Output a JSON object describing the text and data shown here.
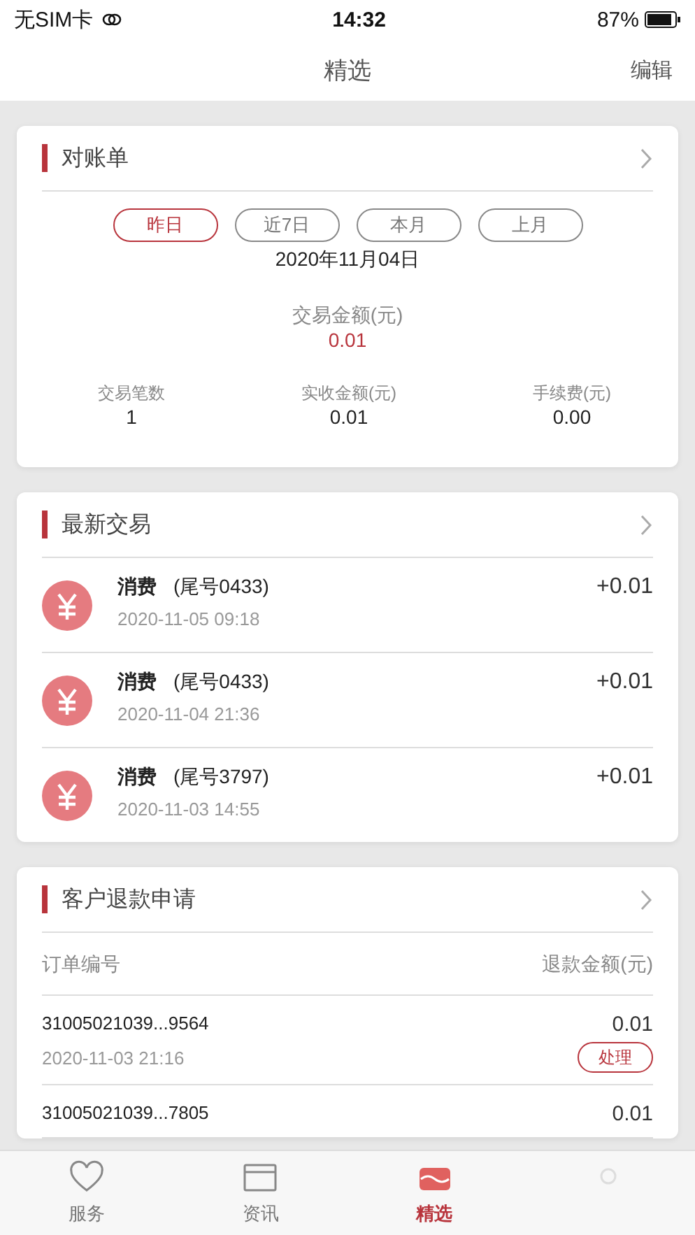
{
  "status_bar": {
    "carrier": "无SIM卡",
    "time": "14:32",
    "battery": "87%"
  },
  "nav": {
    "title": "精选",
    "action": "编辑"
  },
  "statement": {
    "title": "对账单",
    "periods": [
      {
        "label": "昨日",
        "selected": true
      },
      {
        "label": "近7日",
        "selected": false
      },
      {
        "label": "本月",
        "selected": false
      },
      {
        "label": "上月",
        "selected": false
      }
    ],
    "date": "2020年11月04日",
    "amount_label": "交易金额(元)",
    "amount": "0.01",
    "stats": [
      {
        "label": "交易笔数",
        "value": "1"
      },
      {
        "label": "实收金额(元)",
        "value": "0.01"
      },
      {
        "label": "手续费(元)",
        "value": "0.00"
      }
    ]
  },
  "latest": {
    "title": "最新交易",
    "items": [
      {
        "type": "消费",
        "card": "(尾号0433)",
        "time": "2020-11-05 09:18",
        "amount": "+0.01"
      },
      {
        "type": "消费",
        "card": "(尾号0433)",
        "time": "2020-11-04 21:36",
        "amount": "+0.01"
      },
      {
        "type": "消费",
        "card": "(尾号3797)",
        "time": "2020-11-03 14:55",
        "amount": "+0.01"
      }
    ]
  },
  "refunds": {
    "title": "客户退款申请",
    "columns": [
      "订单编号",
      "退款金额(元)"
    ],
    "rows": [
      {
        "order": "31005021039...9564",
        "time": "2020-11-03 21:16",
        "amount": "0.01",
        "action": "处理"
      },
      {
        "order": "31005021039...7805",
        "amount": "0.01"
      }
    ]
  },
  "tab_bar": [
    {
      "label": "服务",
      "selected": false
    },
    {
      "label": "资讯",
      "selected": false
    },
    {
      "label": "精选",
      "selected": true
    },
    {
      "selected": false
    }
  ]
}
